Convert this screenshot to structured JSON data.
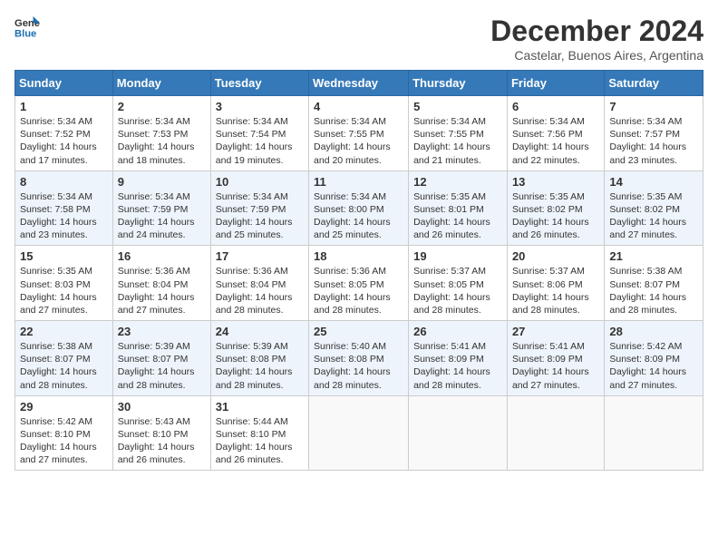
{
  "header": {
    "logo_line1": "General",
    "logo_line2": "Blue",
    "title": "December 2024",
    "subtitle": "Castelar, Buenos Aires, Argentina"
  },
  "calendar": {
    "days_of_week": [
      "Sunday",
      "Monday",
      "Tuesday",
      "Wednesday",
      "Thursday",
      "Friday",
      "Saturday"
    ],
    "weeks": [
      [
        {
          "day": "",
          "text": ""
        },
        {
          "day": "2",
          "text": "Sunrise: 5:34 AM\nSunset: 7:53 PM\nDaylight: 14 hours\nand 18 minutes."
        },
        {
          "day": "3",
          "text": "Sunrise: 5:34 AM\nSunset: 7:54 PM\nDaylight: 14 hours\nand 19 minutes."
        },
        {
          "day": "4",
          "text": "Sunrise: 5:34 AM\nSunset: 7:55 PM\nDaylight: 14 hours\nand 20 minutes."
        },
        {
          "day": "5",
          "text": "Sunrise: 5:34 AM\nSunset: 7:55 PM\nDaylight: 14 hours\nand 21 minutes."
        },
        {
          "day": "6",
          "text": "Sunrise: 5:34 AM\nSunset: 7:56 PM\nDaylight: 14 hours\nand 22 minutes."
        },
        {
          "day": "7",
          "text": "Sunrise: 5:34 AM\nSunset: 7:57 PM\nDaylight: 14 hours\nand 23 minutes."
        }
      ],
      [
        {
          "day": "1",
          "text": "Sunrise: 5:34 AM\nSunset: 7:52 PM\nDaylight: 14 hours\nand 17 minutes."
        },
        {
          "day": "",
          "text": ""
        },
        {
          "day": "",
          "text": ""
        },
        {
          "day": "",
          "text": ""
        },
        {
          "day": "",
          "text": ""
        },
        {
          "day": "",
          "text": ""
        },
        {
          "day": "",
          "text": ""
        }
      ],
      [
        {
          "day": "8",
          "text": "Sunrise: 5:34 AM\nSunset: 7:58 PM\nDaylight: 14 hours\nand 23 minutes."
        },
        {
          "day": "9",
          "text": "Sunrise: 5:34 AM\nSunset: 7:59 PM\nDaylight: 14 hours\nand 24 minutes."
        },
        {
          "day": "10",
          "text": "Sunrise: 5:34 AM\nSunset: 7:59 PM\nDaylight: 14 hours\nand 25 minutes."
        },
        {
          "day": "11",
          "text": "Sunrise: 5:34 AM\nSunset: 8:00 PM\nDaylight: 14 hours\nand 25 minutes."
        },
        {
          "day": "12",
          "text": "Sunrise: 5:35 AM\nSunset: 8:01 PM\nDaylight: 14 hours\nand 26 minutes."
        },
        {
          "day": "13",
          "text": "Sunrise: 5:35 AM\nSunset: 8:02 PM\nDaylight: 14 hours\nand 26 minutes."
        },
        {
          "day": "14",
          "text": "Sunrise: 5:35 AM\nSunset: 8:02 PM\nDaylight: 14 hours\nand 27 minutes."
        }
      ],
      [
        {
          "day": "15",
          "text": "Sunrise: 5:35 AM\nSunset: 8:03 PM\nDaylight: 14 hours\nand 27 minutes."
        },
        {
          "day": "16",
          "text": "Sunrise: 5:36 AM\nSunset: 8:04 PM\nDaylight: 14 hours\nand 27 minutes."
        },
        {
          "day": "17",
          "text": "Sunrise: 5:36 AM\nSunset: 8:04 PM\nDaylight: 14 hours\nand 28 minutes."
        },
        {
          "day": "18",
          "text": "Sunrise: 5:36 AM\nSunset: 8:05 PM\nDaylight: 14 hours\nand 28 minutes."
        },
        {
          "day": "19",
          "text": "Sunrise: 5:37 AM\nSunset: 8:05 PM\nDaylight: 14 hours\nand 28 minutes."
        },
        {
          "day": "20",
          "text": "Sunrise: 5:37 AM\nSunset: 8:06 PM\nDaylight: 14 hours\nand 28 minutes."
        },
        {
          "day": "21",
          "text": "Sunrise: 5:38 AM\nSunset: 8:07 PM\nDaylight: 14 hours\nand 28 minutes."
        }
      ],
      [
        {
          "day": "22",
          "text": "Sunrise: 5:38 AM\nSunset: 8:07 PM\nDaylight: 14 hours\nand 28 minutes."
        },
        {
          "day": "23",
          "text": "Sunrise: 5:39 AM\nSunset: 8:07 PM\nDaylight: 14 hours\nand 28 minutes."
        },
        {
          "day": "24",
          "text": "Sunrise: 5:39 AM\nSunset: 8:08 PM\nDaylight: 14 hours\nand 28 minutes."
        },
        {
          "day": "25",
          "text": "Sunrise: 5:40 AM\nSunset: 8:08 PM\nDaylight: 14 hours\nand 28 minutes."
        },
        {
          "day": "26",
          "text": "Sunrise: 5:41 AM\nSunset: 8:09 PM\nDaylight: 14 hours\nand 28 minutes."
        },
        {
          "day": "27",
          "text": "Sunrise: 5:41 AM\nSunset: 8:09 PM\nDaylight: 14 hours\nand 27 minutes."
        },
        {
          "day": "28",
          "text": "Sunrise: 5:42 AM\nSunset: 8:09 PM\nDaylight: 14 hours\nand 27 minutes."
        }
      ],
      [
        {
          "day": "29",
          "text": "Sunrise: 5:42 AM\nSunset: 8:10 PM\nDaylight: 14 hours\nand 27 minutes."
        },
        {
          "day": "30",
          "text": "Sunrise: 5:43 AM\nSunset: 8:10 PM\nDaylight: 14 hours\nand 26 minutes."
        },
        {
          "day": "31",
          "text": "Sunrise: 5:44 AM\nSunset: 8:10 PM\nDaylight: 14 hours\nand 26 minutes."
        },
        {
          "day": "",
          "text": ""
        },
        {
          "day": "",
          "text": ""
        },
        {
          "day": "",
          "text": ""
        },
        {
          "day": "",
          "text": ""
        }
      ]
    ]
  }
}
